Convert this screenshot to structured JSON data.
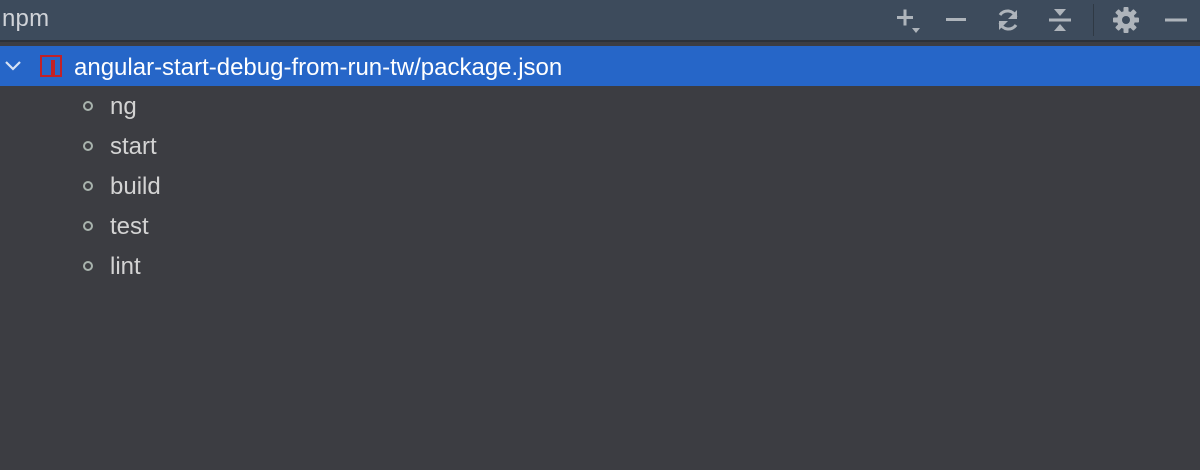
{
  "panel": {
    "title": "npm"
  },
  "toolbar": {
    "buttons": [
      {
        "name": "add-icon",
        "tooltip": ""
      },
      {
        "name": "remove-icon",
        "tooltip": ""
      },
      {
        "name": "refresh-icon",
        "tooltip": ""
      },
      {
        "name": "collapse-all-icon",
        "tooltip": ""
      },
      {
        "name": "gear-icon",
        "tooltip": ""
      },
      {
        "name": "minimize-icon",
        "tooltip": ""
      }
    ]
  },
  "tree": {
    "root": {
      "label": "angular-start-debug-from-run-tw/package.json",
      "icon": "npm-package-icon",
      "expanded": true,
      "selected": true
    },
    "scripts": [
      {
        "label": "ng"
      },
      {
        "label": "start"
      },
      {
        "label": "build"
      },
      {
        "label": "test"
      },
      {
        "label": "lint"
      }
    ]
  },
  "colors": {
    "title_bar": "#3d4b5c",
    "background": "#3c3d42",
    "selection": "#2666c8",
    "npm_red": "#c12127",
    "icon": "#aeb4bb"
  }
}
